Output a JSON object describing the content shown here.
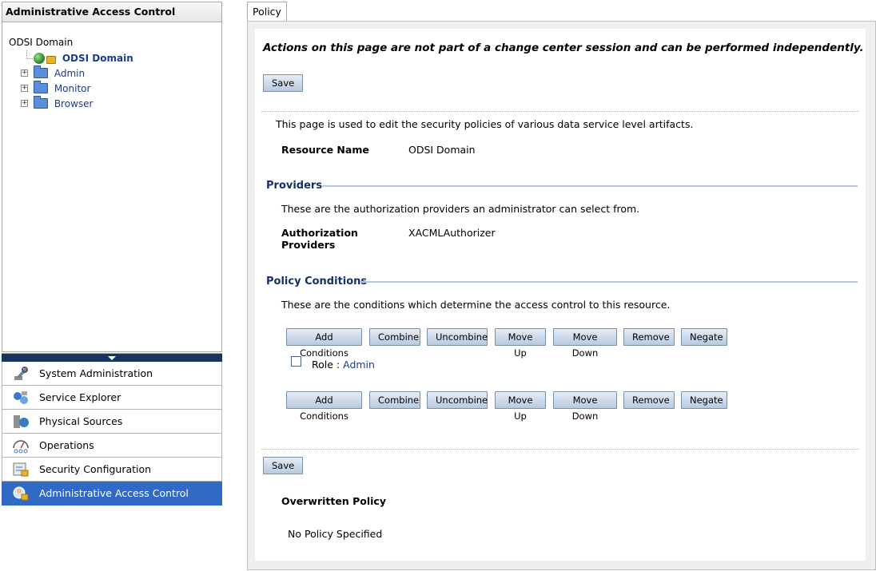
{
  "left_panel": {
    "header": "Administrative Access Control",
    "tree": {
      "root_label": "ODSI Domain",
      "selected_label": "ODSI Domain",
      "children": [
        "Admin",
        "Monitor",
        "Browser"
      ]
    },
    "nav_items": [
      {
        "label": "System Administration",
        "icon": "wrench-icon",
        "active": false
      },
      {
        "label": "Service Explorer",
        "icon": "services-icon",
        "active": false
      },
      {
        "label": "Physical Sources",
        "icon": "server-icon",
        "active": false
      },
      {
        "label": "Operations",
        "icon": "gauge-icon",
        "active": false
      },
      {
        "label": "Security Configuration",
        "icon": "security-config-icon",
        "active": false
      },
      {
        "label": "Administrative Access Control",
        "icon": "admin-access-icon",
        "active": true
      }
    ]
  },
  "right_panel": {
    "tab_label": "Policy",
    "notice": "Actions on this page are not part of a change center session and can be performed independently.",
    "save_label": "Save",
    "description": "This page is used to edit the security policies of various data service level artifacts.",
    "resource_name_label": "Resource Name",
    "resource_name_value": "ODSI Domain",
    "providers": {
      "title": "Providers",
      "description": "These are the authorization providers an administrator can select from.",
      "label_line1": "Authorization",
      "label_line2": "Providers",
      "value": "XACMLAuthorizer"
    },
    "policy_conditions": {
      "title": "Policy Conditions",
      "description": "These are the conditions which determine the access control to this resource.",
      "buttons": [
        "Add Conditions",
        "Combine",
        "Uncombine",
        "Move Up",
        "Move Down",
        "Remove",
        "Negate"
      ],
      "condition_prefix": "Role :",
      "condition_value": "Admin"
    },
    "overwritten_policy": {
      "title": "Overwritten Policy",
      "value": "No Policy Specified"
    }
  },
  "colors": {
    "active_nav": "#316ac5",
    "section_title": "#14306b",
    "splitter": "#17365f"
  }
}
